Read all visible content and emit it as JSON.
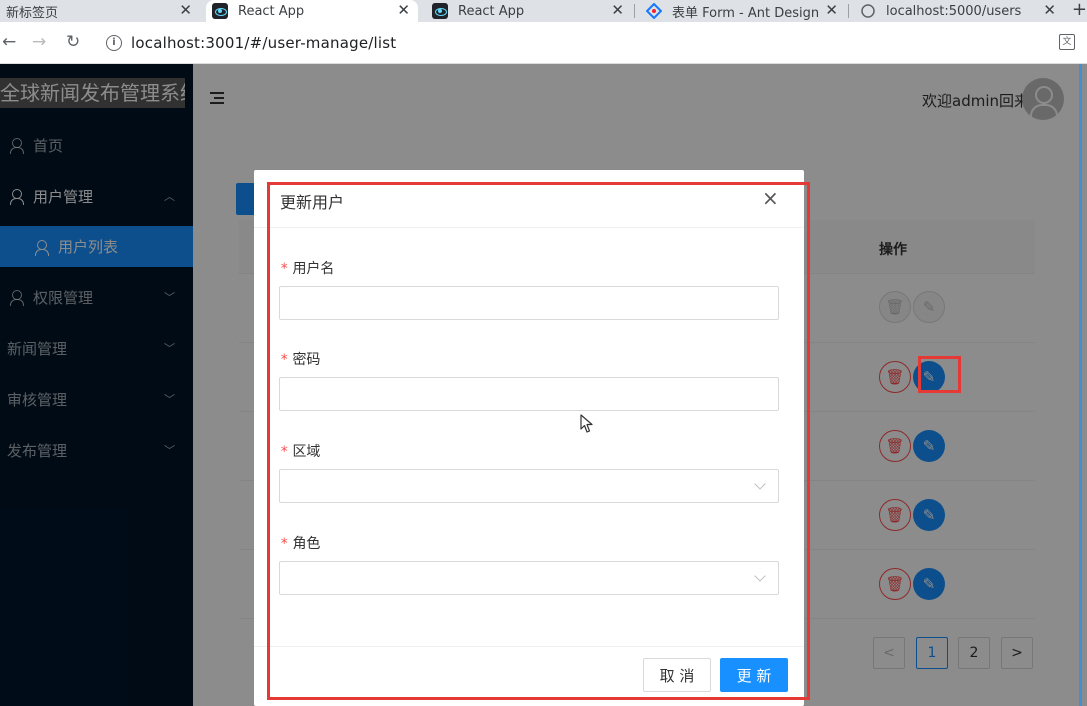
{
  "browser": {
    "tabs": [
      {
        "title": "新标签页",
        "active": false
      },
      {
        "title": "React App",
        "active": true
      },
      {
        "title": "React App",
        "active": false
      },
      {
        "title": "表单 Form - Ant Design",
        "active": false
      },
      {
        "title": "localhost:5000/users",
        "active": false
      }
    ],
    "url": "localhost:3001/#/user-manage/list"
  },
  "sidebar": {
    "logo": "全球新闻发布管理系统",
    "items": [
      {
        "label": "首页"
      },
      {
        "label": "用户管理"
      },
      {
        "label": "用户列表"
      },
      {
        "label": "权限管理"
      },
      {
        "label": "新闻管理"
      },
      {
        "label": "审核管理"
      },
      {
        "label": "发布管理"
      }
    ]
  },
  "header": {
    "welcome": "欢迎admin回来"
  },
  "table": {
    "action_header": "操作"
  },
  "pagination": {
    "pages": [
      "1",
      "2"
    ],
    "current": "1",
    "prev": "<",
    "next": ">"
  },
  "modal": {
    "title": "更新用户",
    "close": "×",
    "fields": {
      "username": {
        "label": "用户名",
        "value": ""
      },
      "password": {
        "label": "密码",
        "value": ""
      },
      "region": {
        "label": "区域",
        "value": ""
      },
      "role": {
        "label": "角色",
        "value": ""
      }
    },
    "required_mark": "*",
    "cancel_label": "取 消",
    "ok_label": "更 新"
  },
  "colors": {
    "primary": "#1890ff",
    "sider": "#001529",
    "danger": "#ff4d4f",
    "annotation": "#e53935"
  }
}
